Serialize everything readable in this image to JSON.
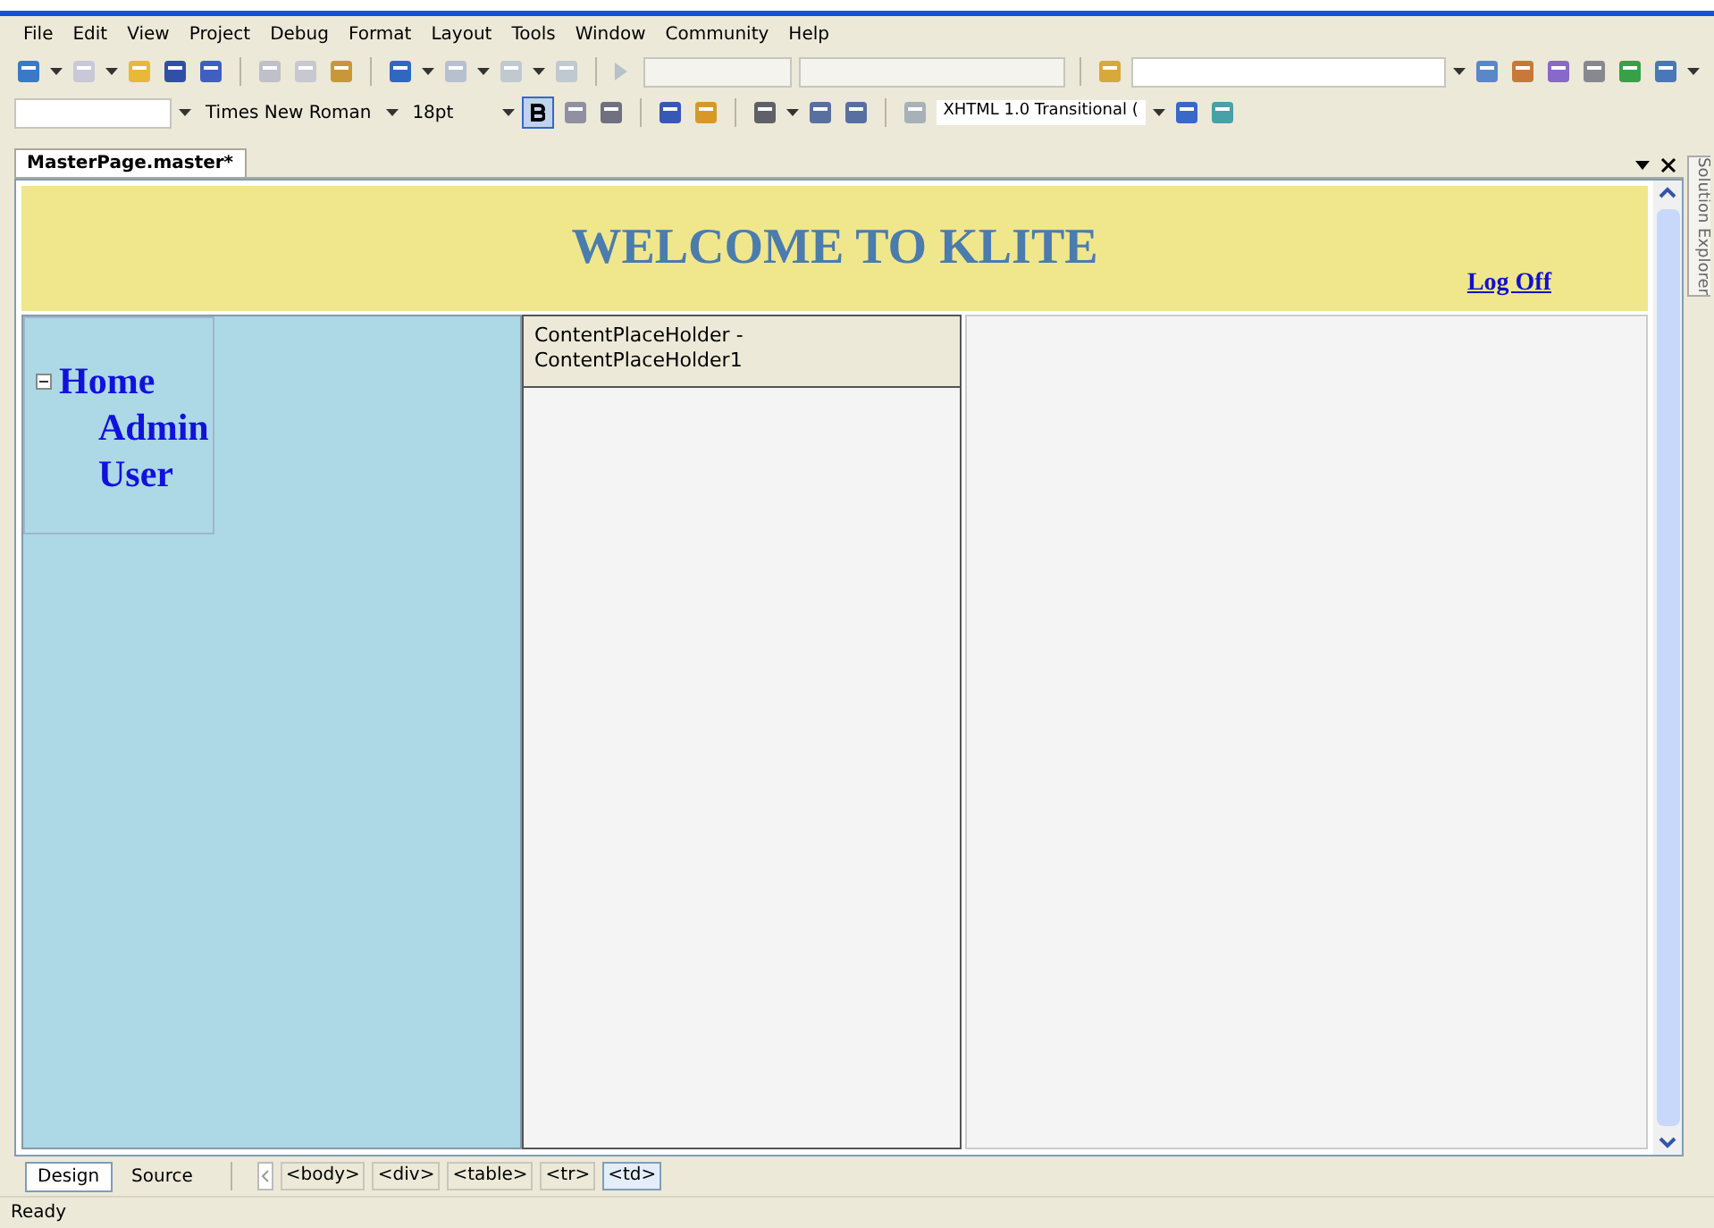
{
  "menu": [
    "File",
    "Edit",
    "View",
    "Project",
    "Debug",
    "Format",
    "Layout",
    "Tools",
    "Window",
    "Community",
    "Help"
  ],
  "format_toolbar": {
    "font_name": "Times New Roman",
    "font_size": "18pt",
    "bold_selected": true,
    "doctype": "XHTML 1.0 Transitional ("
  },
  "document_tab": {
    "title": "MasterPage.master*"
  },
  "design": {
    "header": "WELCOME TO KLITE",
    "logoff_link": "Log Off",
    "tree": [
      {
        "label": "Home",
        "expanded": true,
        "children": [
          {
            "label": "Admin"
          },
          {
            "label": "User"
          }
        ]
      }
    ],
    "placeholder_title": "ContentPlaceHolder - ContentPlaceHolder1"
  },
  "side_tab": "Solution Explorer",
  "view_tabs": [
    {
      "label": "Design",
      "selected": true
    },
    {
      "label": "Source",
      "selected": false
    }
  ],
  "tag_path": [
    {
      "label": "<body>",
      "selected": false
    },
    {
      "label": "<div>",
      "selected": false
    },
    {
      "label": "<table>",
      "selected": false
    },
    {
      "label": "<tr>",
      "selected": false
    },
    {
      "label": "<td>",
      "selected": true
    }
  ],
  "status_bar": "Ready"
}
